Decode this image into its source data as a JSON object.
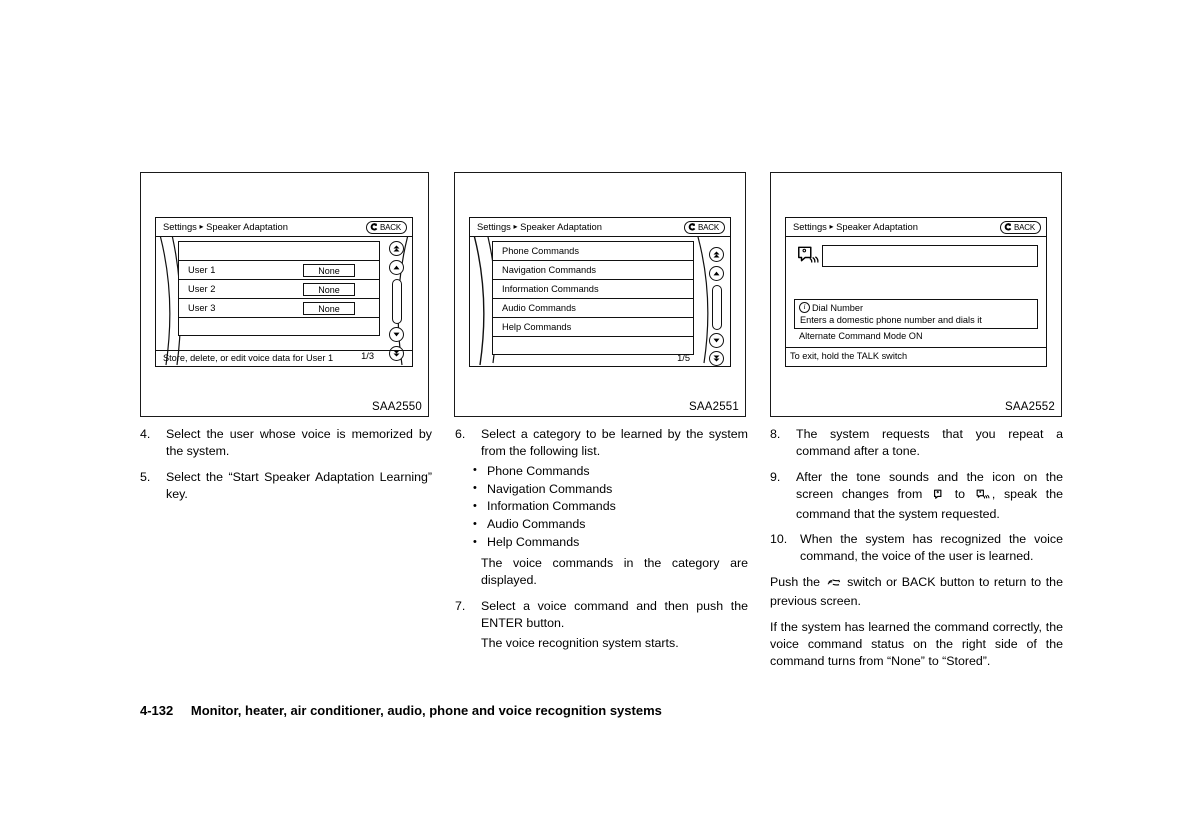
{
  "figures": [
    {
      "code": "SAA2550",
      "screen": {
        "title": "Settings",
        "separator": "▸",
        "subtitle": "Speaker Adaptation",
        "back_label": "BACK",
        "back_icon": "back-arrow-icon",
        "rows": [
          {
            "label": "",
            "value": ""
          },
          {
            "label": "User 1",
            "value": "None"
          },
          {
            "label": "User 2",
            "value": "None"
          },
          {
            "label": "User 3",
            "value": "None"
          },
          {
            "label": "",
            "value": ""
          }
        ],
        "page_indicator": "1/3",
        "status_text": "Store, delete, or edit voice data for User 1",
        "scroll_icons": [
          "double-up-arrow-icon",
          "up-arrow-icon",
          "scroll-thumb",
          "down-arrow-icon",
          "double-down-arrow-icon"
        ]
      }
    },
    {
      "code": "SAA2551",
      "screen": {
        "title": "Settings",
        "separator": "▸",
        "subtitle": "Speaker Adaptation",
        "back_label": "BACK",
        "back_icon": "back-arrow-icon",
        "rows": [
          {
            "label": "Phone Commands",
            "value": ""
          },
          {
            "label": "Navigation Commands",
            "value": ""
          },
          {
            "label": "Information Commands",
            "value": ""
          },
          {
            "label": "Audio Commands",
            "value": ""
          },
          {
            "label": "Help Commands",
            "value": ""
          },
          {
            "label": "",
            "value": ""
          }
        ],
        "page_indicator": "1/5",
        "scroll_icons": [
          "double-up-arrow-icon",
          "up-arrow-icon",
          "scroll-thumb",
          "down-arrow-icon",
          "double-down-arrow-icon"
        ]
      }
    },
    {
      "code": "SAA2552",
      "screen": {
        "title": "Settings",
        "separator": "▸",
        "subtitle": "Speaker Adaptation",
        "back_label": "BACK",
        "back_icon": "back-arrow-icon",
        "voice_icon": "speaking-face-icon",
        "input_value": "",
        "info_title": "Dial Number",
        "info_icon": "info-circle-icon",
        "info_desc": "Enters a domestic phone number and dials it",
        "mode_text": "Alternate Command Mode ON",
        "exit_text": "To exit, hold the TALK switch"
      }
    }
  ],
  "col1": {
    "steps": [
      {
        "num": "4.",
        "text": "Select the user whose voice is memorized by the system."
      },
      {
        "num": "5.",
        "text": "Select the “Start Speaker Adaptation Learning” key."
      }
    ]
  },
  "col2": {
    "step6": {
      "num": "6.",
      "text": "Select a category to be learned by the system from the following list."
    },
    "bullets": [
      "Phone Commands",
      "Navigation Commands",
      "Information Commands",
      "Audio Commands",
      "Help Commands"
    ],
    "note6": "The voice commands in the category are displayed.",
    "step7": {
      "num": "7.",
      "text": "Select a voice command and then push the ENTER button."
    },
    "note7": "The voice recognition system starts."
  },
  "col3": {
    "step8": {
      "num": "8.",
      "text": "The system requests that you repeat a command after a tone."
    },
    "step9": {
      "num": "9.",
      "text_a": "After the tone sounds and the icon on the screen changes from",
      "icon_a": "mic-idle-icon",
      "text_b": "to",
      "icon_b": "mic-listening-icon",
      "text_c": ", speak the command that the system requested."
    },
    "step10": {
      "num": "10.",
      "text": "When the system has recognized the voice command, the voice of the user is learned."
    },
    "para1": {
      "text_a": "Push the",
      "icon": "talk-switch-icon",
      "text_b": "switch or BACK button to return to the previous screen."
    },
    "para2": "If the system has learned the command correctly, the voice command status on the right side of the command turns from “None” to “Stored”."
  },
  "footer": {
    "page_number": "4-132",
    "title": "Monitor, heater, air conditioner, audio, phone and voice recognition systems"
  }
}
